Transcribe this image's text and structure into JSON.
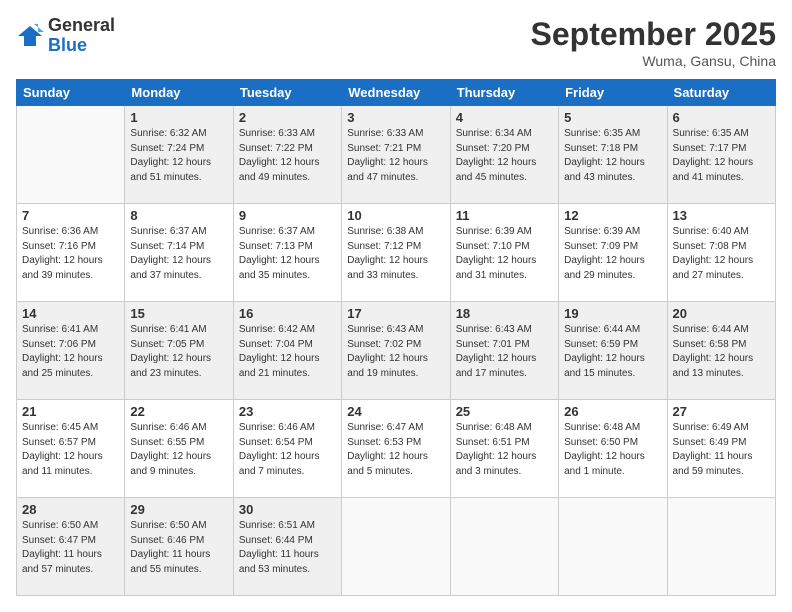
{
  "logo": {
    "general": "General",
    "blue": "Blue"
  },
  "header": {
    "month": "September 2025",
    "location": "Wuma, Gansu, China"
  },
  "weekdays": [
    "Sunday",
    "Monday",
    "Tuesday",
    "Wednesday",
    "Thursday",
    "Friday",
    "Saturday"
  ],
  "weeks": [
    [
      {
        "day": "",
        "info": ""
      },
      {
        "day": "1",
        "info": "Sunrise: 6:32 AM\nSunset: 7:24 PM\nDaylight: 12 hours\nand 51 minutes."
      },
      {
        "day": "2",
        "info": "Sunrise: 6:33 AM\nSunset: 7:22 PM\nDaylight: 12 hours\nand 49 minutes."
      },
      {
        "day": "3",
        "info": "Sunrise: 6:33 AM\nSunset: 7:21 PM\nDaylight: 12 hours\nand 47 minutes."
      },
      {
        "day": "4",
        "info": "Sunrise: 6:34 AM\nSunset: 7:20 PM\nDaylight: 12 hours\nand 45 minutes."
      },
      {
        "day": "5",
        "info": "Sunrise: 6:35 AM\nSunset: 7:18 PM\nDaylight: 12 hours\nand 43 minutes."
      },
      {
        "day": "6",
        "info": "Sunrise: 6:35 AM\nSunset: 7:17 PM\nDaylight: 12 hours\nand 41 minutes."
      }
    ],
    [
      {
        "day": "7",
        "info": "Sunrise: 6:36 AM\nSunset: 7:16 PM\nDaylight: 12 hours\nand 39 minutes."
      },
      {
        "day": "8",
        "info": "Sunrise: 6:37 AM\nSunset: 7:14 PM\nDaylight: 12 hours\nand 37 minutes."
      },
      {
        "day": "9",
        "info": "Sunrise: 6:37 AM\nSunset: 7:13 PM\nDaylight: 12 hours\nand 35 minutes."
      },
      {
        "day": "10",
        "info": "Sunrise: 6:38 AM\nSunset: 7:12 PM\nDaylight: 12 hours\nand 33 minutes."
      },
      {
        "day": "11",
        "info": "Sunrise: 6:39 AM\nSunset: 7:10 PM\nDaylight: 12 hours\nand 31 minutes."
      },
      {
        "day": "12",
        "info": "Sunrise: 6:39 AM\nSunset: 7:09 PM\nDaylight: 12 hours\nand 29 minutes."
      },
      {
        "day": "13",
        "info": "Sunrise: 6:40 AM\nSunset: 7:08 PM\nDaylight: 12 hours\nand 27 minutes."
      }
    ],
    [
      {
        "day": "14",
        "info": "Sunrise: 6:41 AM\nSunset: 7:06 PM\nDaylight: 12 hours\nand 25 minutes."
      },
      {
        "day": "15",
        "info": "Sunrise: 6:41 AM\nSunset: 7:05 PM\nDaylight: 12 hours\nand 23 minutes."
      },
      {
        "day": "16",
        "info": "Sunrise: 6:42 AM\nSunset: 7:04 PM\nDaylight: 12 hours\nand 21 minutes."
      },
      {
        "day": "17",
        "info": "Sunrise: 6:43 AM\nSunset: 7:02 PM\nDaylight: 12 hours\nand 19 minutes."
      },
      {
        "day": "18",
        "info": "Sunrise: 6:43 AM\nSunset: 7:01 PM\nDaylight: 12 hours\nand 17 minutes."
      },
      {
        "day": "19",
        "info": "Sunrise: 6:44 AM\nSunset: 6:59 PM\nDaylight: 12 hours\nand 15 minutes."
      },
      {
        "day": "20",
        "info": "Sunrise: 6:44 AM\nSunset: 6:58 PM\nDaylight: 12 hours\nand 13 minutes."
      }
    ],
    [
      {
        "day": "21",
        "info": "Sunrise: 6:45 AM\nSunset: 6:57 PM\nDaylight: 12 hours\nand 11 minutes."
      },
      {
        "day": "22",
        "info": "Sunrise: 6:46 AM\nSunset: 6:55 PM\nDaylight: 12 hours\nand 9 minutes."
      },
      {
        "day": "23",
        "info": "Sunrise: 6:46 AM\nSunset: 6:54 PM\nDaylight: 12 hours\nand 7 minutes."
      },
      {
        "day": "24",
        "info": "Sunrise: 6:47 AM\nSunset: 6:53 PM\nDaylight: 12 hours\nand 5 minutes."
      },
      {
        "day": "25",
        "info": "Sunrise: 6:48 AM\nSunset: 6:51 PM\nDaylight: 12 hours\nand 3 minutes."
      },
      {
        "day": "26",
        "info": "Sunrise: 6:48 AM\nSunset: 6:50 PM\nDaylight: 12 hours\nand 1 minute."
      },
      {
        "day": "27",
        "info": "Sunrise: 6:49 AM\nSunset: 6:49 PM\nDaylight: 11 hours\nand 59 minutes."
      }
    ],
    [
      {
        "day": "28",
        "info": "Sunrise: 6:50 AM\nSunset: 6:47 PM\nDaylight: 11 hours\nand 57 minutes."
      },
      {
        "day": "29",
        "info": "Sunrise: 6:50 AM\nSunset: 6:46 PM\nDaylight: 11 hours\nand 55 minutes."
      },
      {
        "day": "30",
        "info": "Sunrise: 6:51 AM\nSunset: 6:44 PM\nDaylight: 11 hours\nand 53 minutes."
      },
      {
        "day": "",
        "info": ""
      },
      {
        "day": "",
        "info": ""
      },
      {
        "day": "",
        "info": ""
      },
      {
        "day": "",
        "info": ""
      }
    ]
  ]
}
